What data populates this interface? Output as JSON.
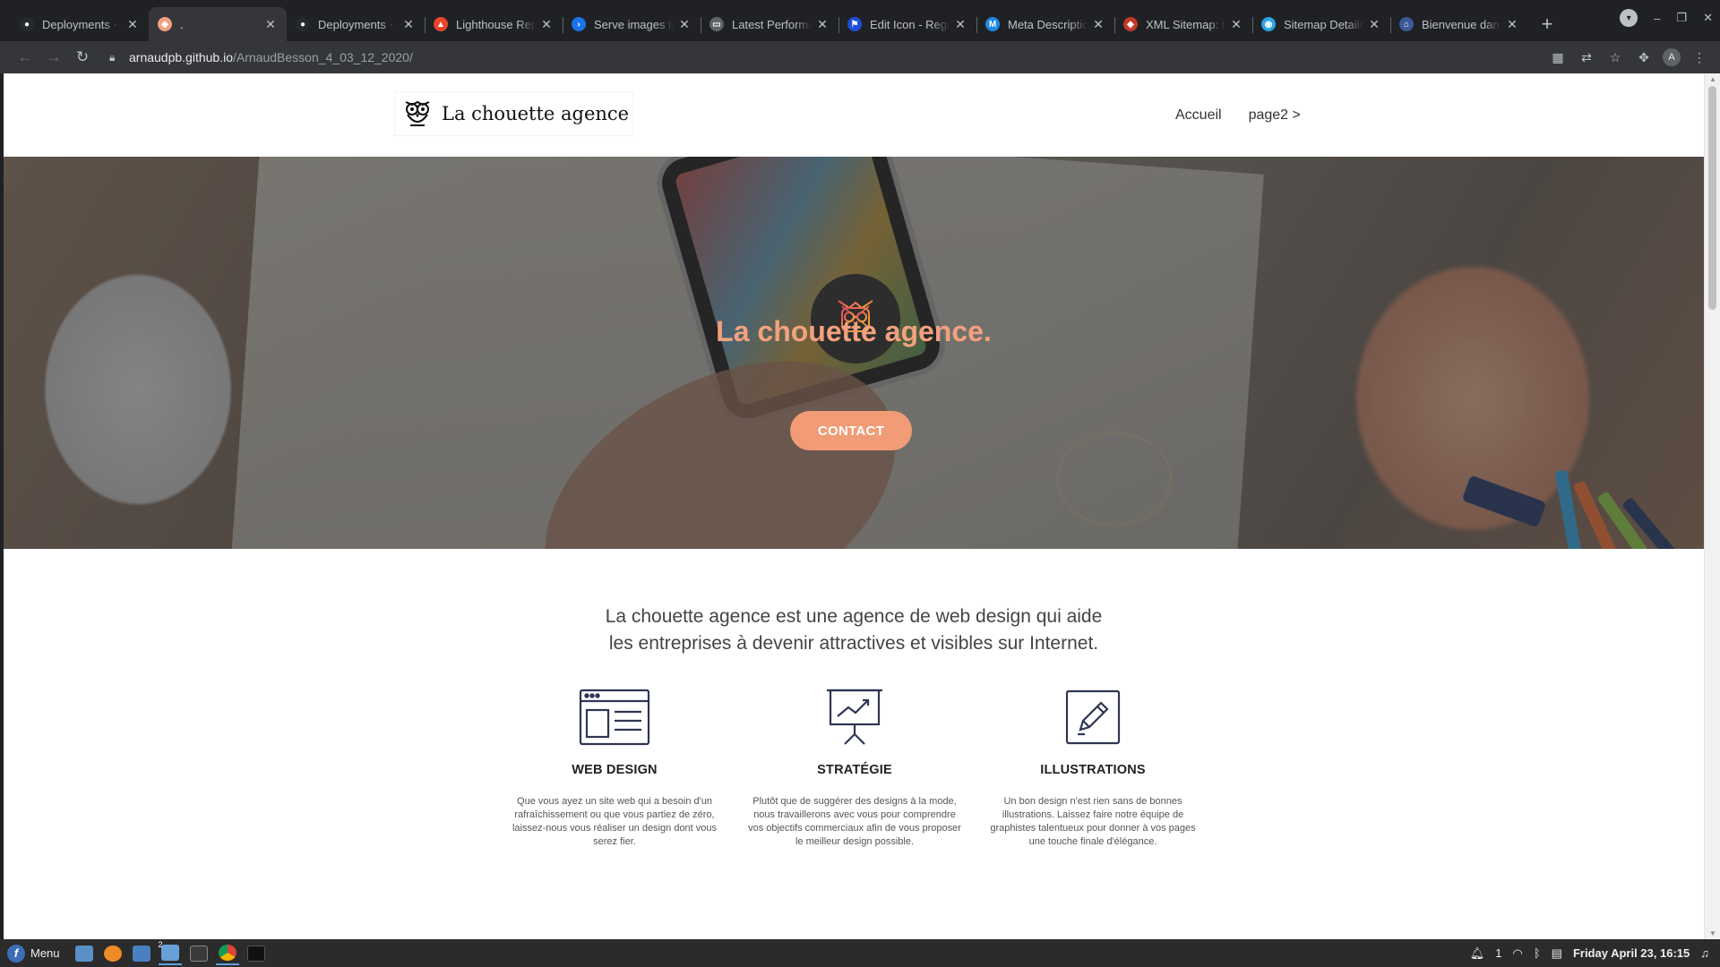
{
  "browser": {
    "tabs": [
      {
        "title": "Deployments · A",
        "favicon_color": "#24292e",
        "favicon": "github-icon",
        "active": false
      },
      {
        "title": ".",
        "favicon_color": "#f0a080",
        "favicon": "owl-favicon-icon",
        "active": true
      },
      {
        "title": "Deployments · A",
        "favicon_color": "#24292e",
        "favicon": "github-icon",
        "active": false
      },
      {
        "title": "Lighthouse Rep",
        "favicon_color": "#e8452c",
        "favicon": "lighthouse-icon",
        "active": false
      },
      {
        "title": "Serve images in",
        "favicon_color": "#1a73e8",
        "favicon": "webdev-icon",
        "active": false
      },
      {
        "title": "Latest Performa",
        "favicon_color": "#5f6368",
        "favicon": "monitor-icon",
        "active": false
      },
      {
        "title": "Edit Icon - Regul",
        "favicon_color": "#1d4ed8",
        "favicon": "flag-icon",
        "active": false
      },
      {
        "title": "Meta Descriptio",
        "favicon_color": "#1e88e5",
        "favicon": "m-icon",
        "active": false
      },
      {
        "title": "XML Sitemap: th",
        "favicon_color": "#c0392b",
        "favicon": "shield-icon",
        "active": false
      },
      {
        "title": "Sitemap Details",
        "favicon_color": "#29a3e3",
        "favicon": "globe-icon",
        "active": false
      },
      {
        "title": "Bienvenue dans",
        "favicon_color": "#3b5998",
        "favicon": "house-icon",
        "active": false
      }
    ],
    "url_host": "arnaudpb.github.io",
    "url_path": "/ArnaudBesson_4_03_12_2020/",
    "profile_initial": "A"
  },
  "site": {
    "logo_text": "La chouette agence",
    "nav": [
      "Accueil",
      "page2 >"
    ],
    "hero_title": "La chouette agence.",
    "contact_label": "CONTACT",
    "intro_line1": "La chouette agence est une agence de web design qui aide",
    "intro_line2": "les entreprises à devenir attractives et visibles sur Internet.",
    "services": [
      {
        "icon": "web-layout-icon",
        "title": "WEB DESIGN",
        "text": "Que vous ayez un site web qui a besoin d'un rafraîchissement ou que vous partiez de zéro, laissez-nous vous réaliser un design dont vous serez fier."
      },
      {
        "icon": "presentation-chart-icon",
        "title": "STRATÉGIE",
        "text": "Plutôt que de suggérer des designs à la mode, nous travaillerons avec vous pour comprendre vos objectifs commerciaux afin de vous proposer le meilleur design possible."
      },
      {
        "icon": "pencil-edit-icon",
        "title": "ILLUSTRATIONS",
        "text": "Un bon design n'est rien sans de bonnes illustrations. Laissez faire notre équipe de graphistes talentueux pour donner à vos pages une touche finale d'élégance."
      }
    ],
    "accent_color": "#f19c76"
  },
  "taskbar": {
    "menu_label": "Menu",
    "notification_count": "1",
    "clock": "Friday April 23, 16:15",
    "files_badge": "2"
  }
}
